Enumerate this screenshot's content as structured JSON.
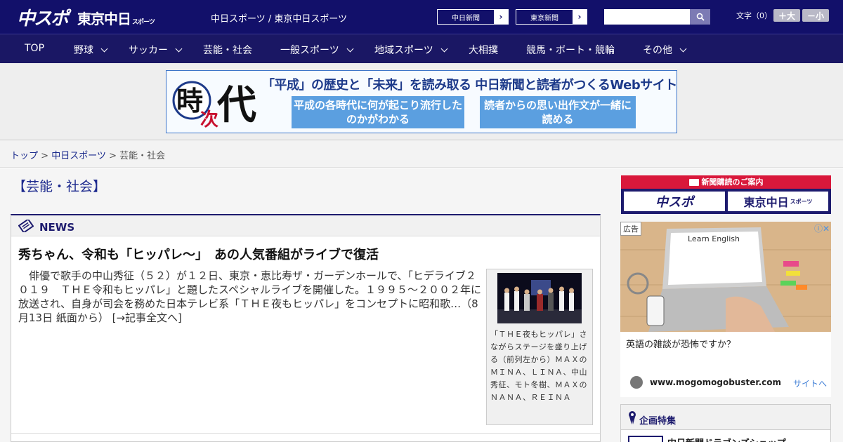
{
  "header": {
    "logo_primary": "中スポ",
    "logo_secondary": "東京中日",
    "logo_secondary_small": "スポーツ",
    "site_link": "中日スポーツ / 東京中日スポーツ",
    "chunichi_btn": "中日新聞",
    "tokyo_btn": "東京新聞",
    "arrow": "›",
    "search_placeholder": "",
    "font_label": "文字（0）",
    "font_bigger": "＋大",
    "font_smaller": "－小"
  },
  "nav": {
    "items": [
      {
        "label": "TOP"
      },
      {
        "label": "野球"
      },
      {
        "label": "サッカー"
      },
      {
        "label": "芸能・社会"
      },
      {
        "label": "一般スポーツ"
      },
      {
        "label": "地域スポーツ"
      },
      {
        "label": "大相撲"
      },
      {
        "label": "競馬・ボート・競輪"
      },
      {
        "label": "その他"
      }
    ]
  },
  "banner": {
    "kanji_1": "時",
    "kanji_2": "次",
    "kanji_3": "代",
    "headline": "「平成」の歴史と「未来」を読み取る 中日新聞と読者がつくるWebサイト",
    "box_left": "平成の各時代に何が起こり流行したのかがわかる",
    "box_right": "読者からの思い出作文が一緒に読める"
  },
  "breadcrumb": {
    "home": "トップ",
    "sep": ">",
    "middle": "中日スポーツ",
    "current": "芸能・社会"
  },
  "section_title": "【芸能・社会】",
  "news": {
    "label": "NEWS",
    "headline": "秀ちゃん、令和も「ヒッパレ～」　あの人気番組がライブで復活",
    "body": "俳優で歌手の中山秀征（５２）が１２日、東京・恵比寿ザ・ガーデンホールで、「ヒデライブ２０１９　ＴＨＥ令和もヒッパレ」と題したスペシャルライブを開催した。１９９５～２００２年に放送され、自身が司会を務めた日本テレビ系「ＴＨＥ夜もヒッパレ」をコンセプトに昭和歌…（8月13日 紙面から）",
    "more": "[→記事全文へ]",
    "caption": "「ＴＨＥ夜もヒッパレ」さながらステージを盛り上げる（前列左から）ＭＡＸのＭＩＮＡ、ＬＩＮＡ、中山秀征、モト冬樹、ＭＡＸのＮＡＮＡ、ＲＥＩＮＡ"
  },
  "sidebar": {
    "subscribe_label": "新聞購読のご案内",
    "logo_a": "中スポ",
    "logo_b": "東京中日",
    "logo_b_small": "スポーツ",
    "ad_tag": "広告",
    "ad_close": "ⓘ✕",
    "ad_image_text": "Learn English",
    "ad_text": "英語の雑談が恐怖ですか？",
    "ad_domain": "www.mogomogobuster.com",
    "ad_cta": "サイトへ",
    "feature_title": "企画特集",
    "feature_item": "中日新聞ドラゴンズショップ"
  },
  "colors": {
    "header_bg": "#12106a",
    "nav_bg": "#1a1764",
    "accent_red": "#d9183b",
    "link_blue": "#1a2a8c"
  }
}
